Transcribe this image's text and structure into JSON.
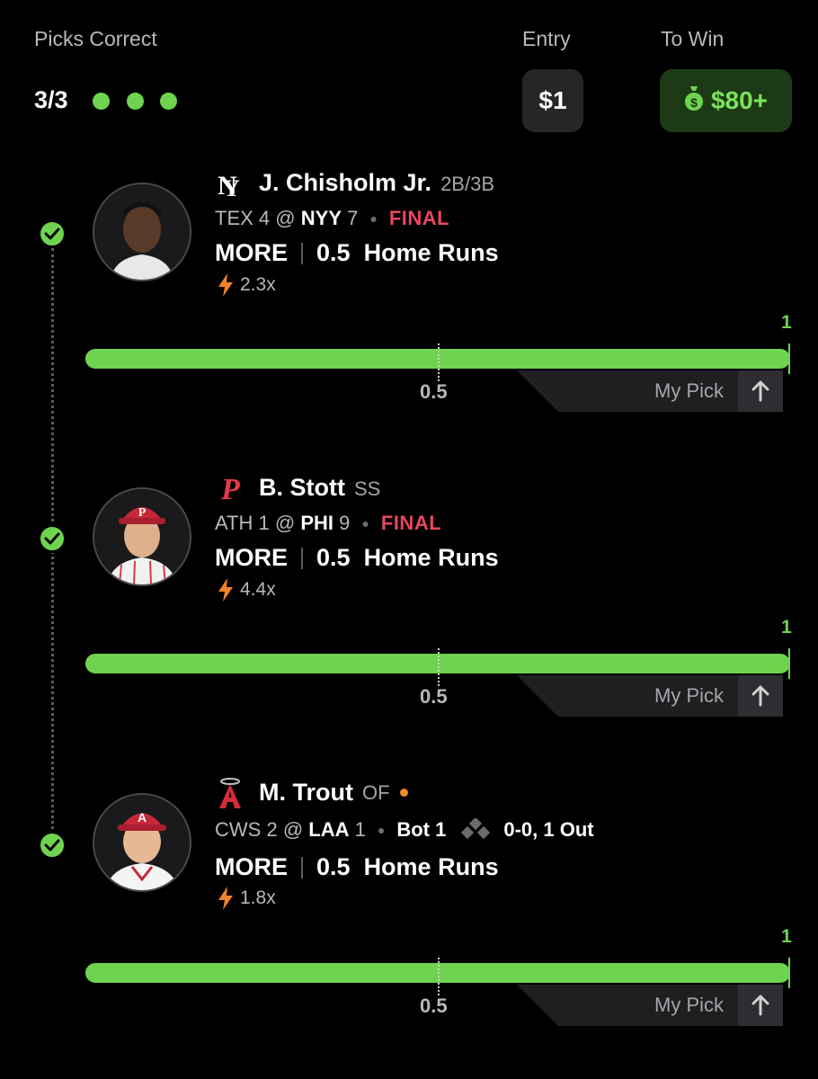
{
  "header": {
    "picks_label": "Picks Correct",
    "picks_value": "3/3",
    "picks_dots": 3,
    "entry_label": "Entry",
    "entry_value": "$1",
    "win_label": "To Win",
    "win_value": "$80+"
  },
  "colors": {
    "accent_green": "#6fd34f",
    "final_red": "#e8475d",
    "live_orange": "#f08a2c",
    "boost_orange": "#f0832a"
  },
  "picks": [
    {
      "player": "J. Chisholm Jr.",
      "position": "2B/3B",
      "team_logo": "yankees-logo",
      "away_team": "TEX",
      "away_score": "4",
      "at": "@",
      "home_team": "NYY",
      "home_score": "7",
      "status": "FINAL",
      "direction": "MORE",
      "line": "0.5",
      "stat": "Home Runs",
      "multiplier": "2.3x",
      "result": "1",
      "bar_line": "0.5",
      "my_pick": "My Pick",
      "progress": 1.0
    },
    {
      "player": "B. Stott",
      "position": "SS",
      "team_logo": "phillies-logo",
      "away_team": "ATH",
      "away_score": "1",
      "at": "@",
      "home_team": "PHI",
      "home_score": "9",
      "status": "FINAL",
      "direction": "MORE",
      "line": "0.5",
      "stat": "Home Runs",
      "multiplier": "4.4x",
      "result": "1",
      "bar_line": "0.5",
      "my_pick": "My Pick",
      "progress": 1.0
    },
    {
      "player": "M. Trout",
      "position": "OF",
      "team_logo": "angels-logo",
      "away_team": "CWS",
      "away_score": "2",
      "at": "@",
      "home_team": "LAA",
      "home_score": "1",
      "inning": "Bot 1",
      "count": "0-0, 1 Out",
      "direction": "MORE",
      "line": "0.5",
      "stat": "Home Runs",
      "multiplier": "1.8x",
      "result": "1",
      "bar_line": "0.5",
      "my_pick": "My Pick",
      "progress": 1.0
    }
  ]
}
